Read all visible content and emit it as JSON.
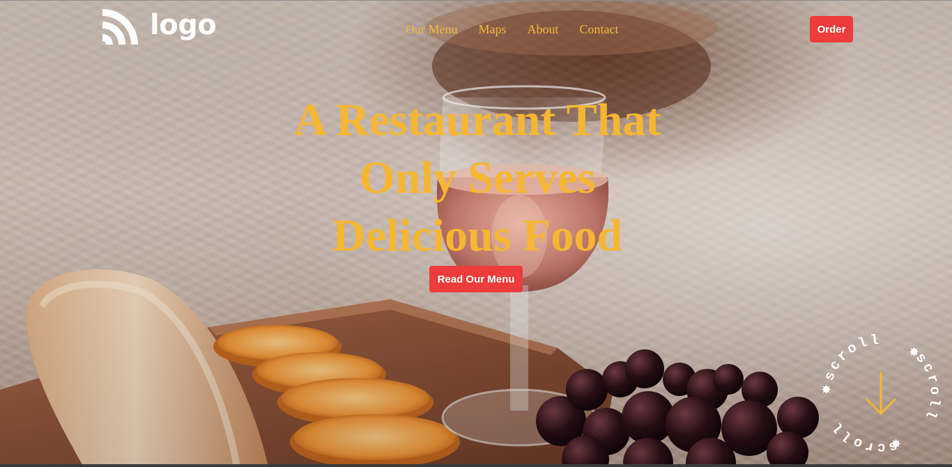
{
  "header": {
    "logo_text": "logo",
    "nav": [
      {
        "label": "Our Menu"
      },
      {
        "label": "Maps"
      },
      {
        "label": "About"
      },
      {
        "label": "Contact"
      }
    ],
    "order_label": "Order"
  },
  "hero": {
    "headline_lines": [
      "A Restaurant That",
      "Only Serves",
      "Delicious Food"
    ],
    "cta_label": "Read Our Menu"
  },
  "scroll_badge": {
    "words": [
      "scroll",
      "scroll",
      "scroll"
    ],
    "icon": "arrow-down-icon"
  },
  "colors": {
    "accent": "#f5b633",
    "button": "#ee3b3b",
    "logo": "#ffffff"
  }
}
